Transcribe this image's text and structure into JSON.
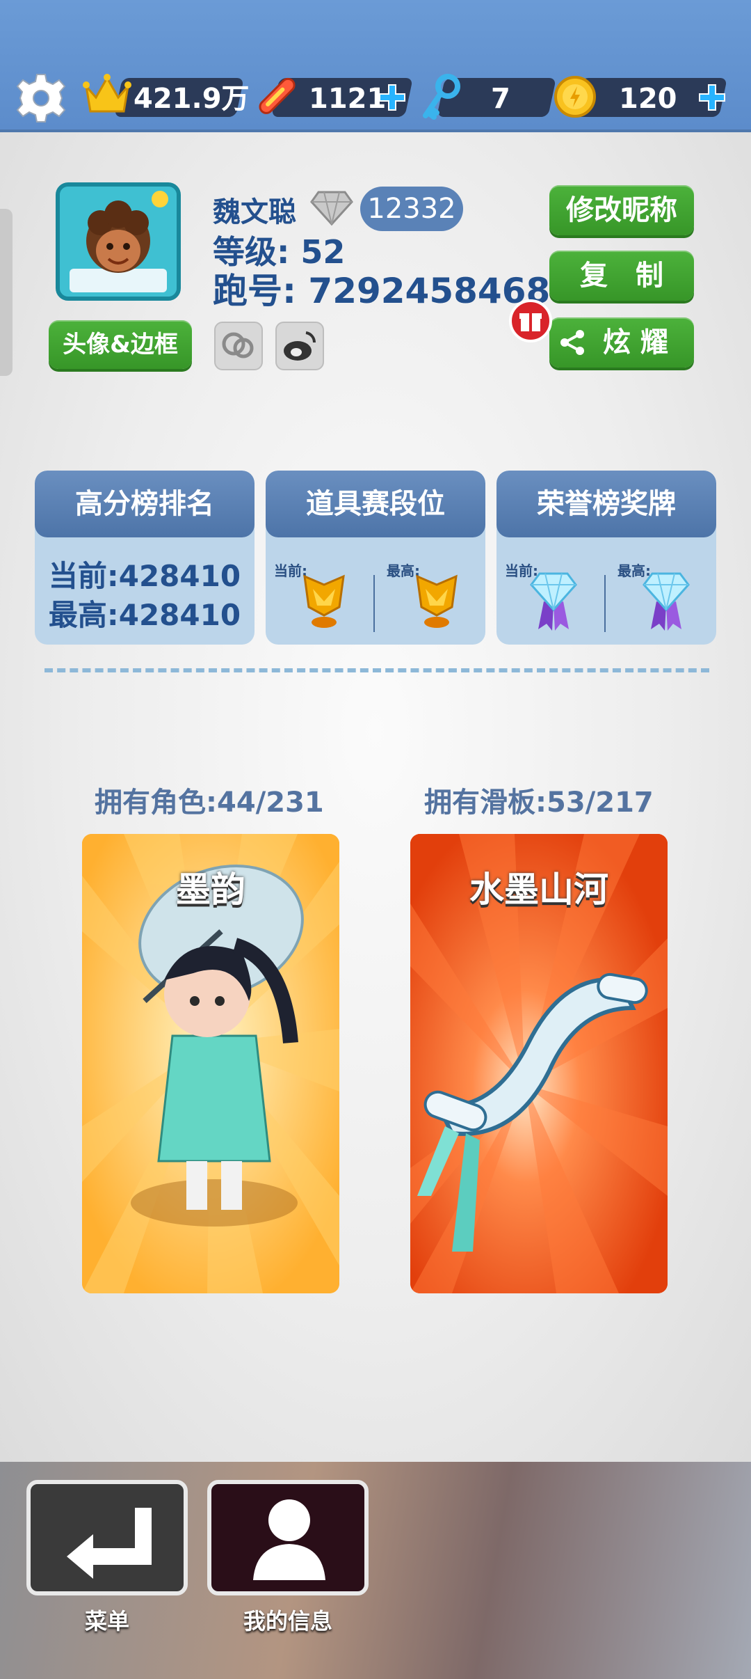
{
  "topbar": {
    "crowns": "421.9万",
    "boards": "1121",
    "keys": "7",
    "coins": "120"
  },
  "profile": {
    "name": "魏文聪",
    "badge_number": "12332",
    "level": "等级: 52",
    "run_id": "跑号: 7292458468",
    "avatar_button": "头像&边框",
    "rename_button": "修改昵称",
    "copy_button": "复　制",
    "share_button": "炫 耀"
  },
  "cards": {
    "highscore": {
      "title": "高分榜排名",
      "current": "当前:428410",
      "best": "最高:428410"
    },
    "props": {
      "title": "道具赛段位",
      "current_label": "当前:",
      "best_label": "最高:"
    },
    "honor": {
      "title": "荣誉榜奖牌",
      "current_label": "当前:",
      "best_label": "最高:"
    }
  },
  "collection": {
    "characters_label": "拥有角色:44/231",
    "boards_label": "拥有滑板:53/217",
    "character_name": "墨韵",
    "board_name": "水墨山河"
  },
  "nav": {
    "menu_label": "菜单",
    "info_label": "我的信息"
  },
  "colors": {
    "topbar": "#6b9bd6",
    "accent_green": "#4cb23b",
    "text_blue": "#23508e",
    "character_card": "#ffb840",
    "board_card": "#e84a12"
  },
  "icons": [
    "gear-icon",
    "crown-icon",
    "hoverboard-icon",
    "key-icon",
    "coin-icon",
    "plus-icon",
    "diamond-icon",
    "gift-icon",
    "share-icon",
    "wechat-icon",
    "weibo-icon",
    "trophy-icon",
    "medal-icon",
    "enter-icon",
    "person-icon"
  ]
}
